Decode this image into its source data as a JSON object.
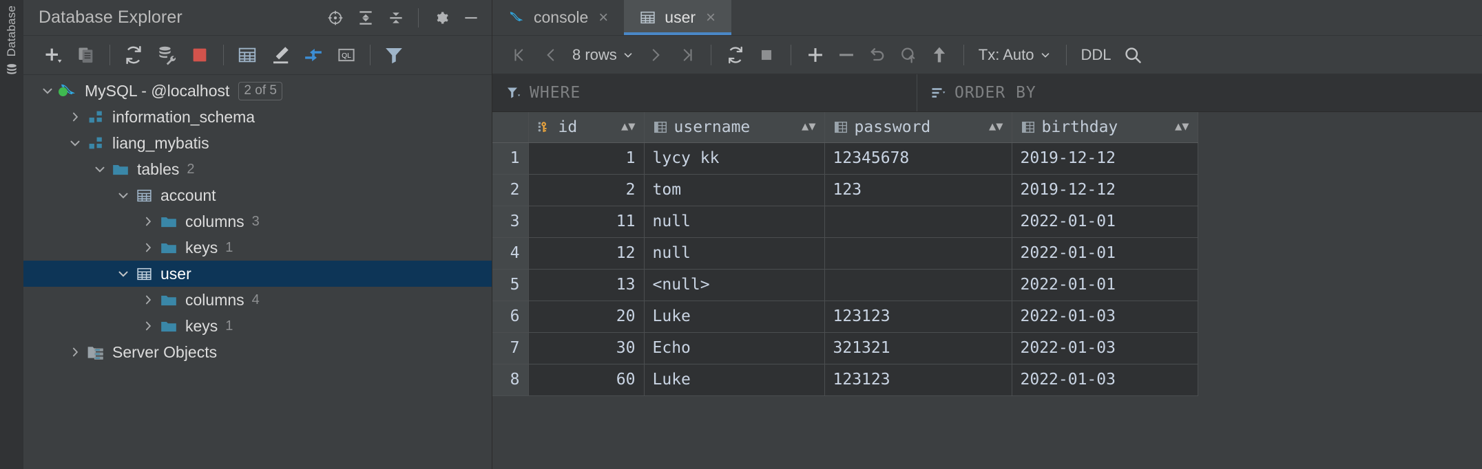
{
  "stripe": {
    "label": "Database",
    "icon": "database-stripe-icon"
  },
  "explorer": {
    "title": "Database Explorer",
    "header_actions": [
      {
        "name": "locate-in-tree-icon",
        "label": "Scroll from Source"
      },
      {
        "name": "expand-all-icon",
        "label": "Expand All"
      },
      {
        "name": "collapse-all-icon",
        "label": "Collapse All"
      },
      {
        "name": "gear-icon",
        "label": "Options"
      },
      {
        "name": "minimize-icon",
        "label": "Hide"
      }
    ],
    "toolbar": [
      {
        "name": "add-icon",
        "label": "New"
      },
      {
        "name": "duplicate-icon",
        "label": "Duplicate"
      },
      {
        "name": "refresh-icon",
        "label": "Refresh"
      },
      {
        "name": "data-source-properties-icon",
        "label": "Data Source Properties"
      },
      {
        "name": "stop-icon",
        "label": "Stop"
      },
      {
        "name": "table-icon",
        "label": "Open Data Editor"
      },
      {
        "name": "modify-icon",
        "label": "Modify"
      },
      {
        "name": "jump-to-source-icon",
        "label": "Jump to Query Console"
      },
      {
        "name": "query-console-icon",
        "label": "QL"
      },
      {
        "name": "filter-icon",
        "label": "Filter"
      }
    ],
    "tree": [
      {
        "label": "MySQL - @localhost",
        "icon": "mysql-dolphin-icon",
        "twisty": "expanded",
        "indent": 0,
        "badge": "2 of 5",
        "status": "connected",
        "selected": false
      },
      {
        "label": "information_schema",
        "icon": "schema-icon",
        "twisty": "collapsed",
        "indent": 1,
        "selected": false
      },
      {
        "label": "liang_mybatis",
        "icon": "schema-icon",
        "twisty": "expanded",
        "indent": 1,
        "selected": false
      },
      {
        "label": "tables",
        "icon": "folder-icon",
        "twisty": "expanded",
        "indent": 2,
        "count": "2",
        "selected": false
      },
      {
        "label": "account",
        "icon": "table-icon",
        "twisty": "expanded",
        "indent": 3,
        "selected": false
      },
      {
        "label": "columns",
        "icon": "folder-icon",
        "twisty": "collapsed",
        "indent": 4,
        "count": "3",
        "selected": false
      },
      {
        "label": "keys",
        "icon": "folder-icon",
        "twisty": "collapsed",
        "indent": 4,
        "count": "1",
        "selected": false
      },
      {
        "label": "user",
        "icon": "table-icon",
        "twisty": "expanded",
        "indent": 3,
        "selected": true
      },
      {
        "label": "columns",
        "icon": "folder-icon",
        "twisty": "collapsed",
        "indent": 4,
        "count": "4",
        "selected": false
      },
      {
        "label": "keys",
        "icon": "folder-icon",
        "twisty": "collapsed",
        "indent": 4,
        "count": "1",
        "selected": false
      },
      {
        "label": "Server Objects",
        "icon": "server-objects-icon",
        "twisty": "collapsed",
        "indent": 1,
        "selected": false
      }
    ]
  },
  "tabs": [
    {
      "label": "console",
      "icon": "mysql-dolphin-icon",
      "close": "×",
      "active": false
    },
    {
      "label": "user",
      "icon": "table-icon",
      "close": "×",
      "active": true
    }
  ],
  "grid_toolbar": {
    "first_page": "first-page-icon",
    "prev_page": "prev-page-icon",
    "rows_label": "8 rows",
    "next_page": "next-page-icon",
    "last_page": "last-page-icon",
    "reload": "reload-icon",
    "stop": "stop-icon",
    "add_row": "add-row-icon",
    "delete_row": "delete-row-icon",
    "revert": "revert-icon",
    "revert_selected": "revert-selected-icon",
    "submit": "submit-icon",
    "tx_label": "Tx: Auto",
    "ddl_label": "DDL",
    "search": "search-icon"
  },
  "filters": {
    "where_label": "WHERE",
    "where_icon": "filter-icon",
    "order_label": "ORDER BY",
    "order_icon": "sort-icon"
  },
  "table": {
    "columns": [
      {
        "name": "id",
        "icon": "primary-key-icon"
      },
      {
        "name": "username",
        "icon": "column-icon"
      },
      {
        "name": "password",
        "icon": "column-icon"
      },
      {
        "name": "birthday",
        "icon": "column-icon"
      }
    ],
    "rows": [
      {
        "n": "1",
        "id": "1",
        "username": "lycy kk",
        "password": "12345678",
        "birthday": "2019-12-12",
        "username_null": false
      },
      {
        "n": "2",
        "id": "2",
        "username": "tom",
        "password": "123",
        "birthday": "2019-12-12",
        "username_null": false
      },
      {
        "n": "3",
        "id": "11",
        "username": "null",
        "password": "",
        "birthday": "2022-01-01",
        "username_null": false
      },
      {
        "n": "4",
        "id": "12",
        "username": "null",
        "password": "",
        "birthday": "2022-01-01",
        "username_null": false
      },
      {
        "n": "5",
        "id": "13",
        "username": "<null>",
        "password": "",
        "birthday": "2022-01-01",
        "username_null": true
      },
      {
        "n": "6",
        "id": "20",
        "username": "Luke",
        "password": "123123",
        "birthday": "2022-01-03",
        "username_null": false
      },
      {
        "n": "7",
        "id": "30",
        "username": "Echo",
        "password": "321321",
        "birthday": "2022-01-03",
        "username_null": false
      },
      {
        "n": "8",
        "id": "60",
        "username": "Luke",
        "password": "123123",
        "birthday": "2022-01-03",
        "username_null": false
      }
    ]
  },
  "colors": {
    "accent_blue": "#4a88c7",
    "selection_blue": "#0d3557",
    "folder_blue": "#3a87a8",
    "stop_red": "#d2534c",
    "key_gold": "#e8a33d",
    "status_green": "#3fb950",
    "panel_bg": "#3c3f41",
    "grid_bg": "#2f3133"
  }
}
